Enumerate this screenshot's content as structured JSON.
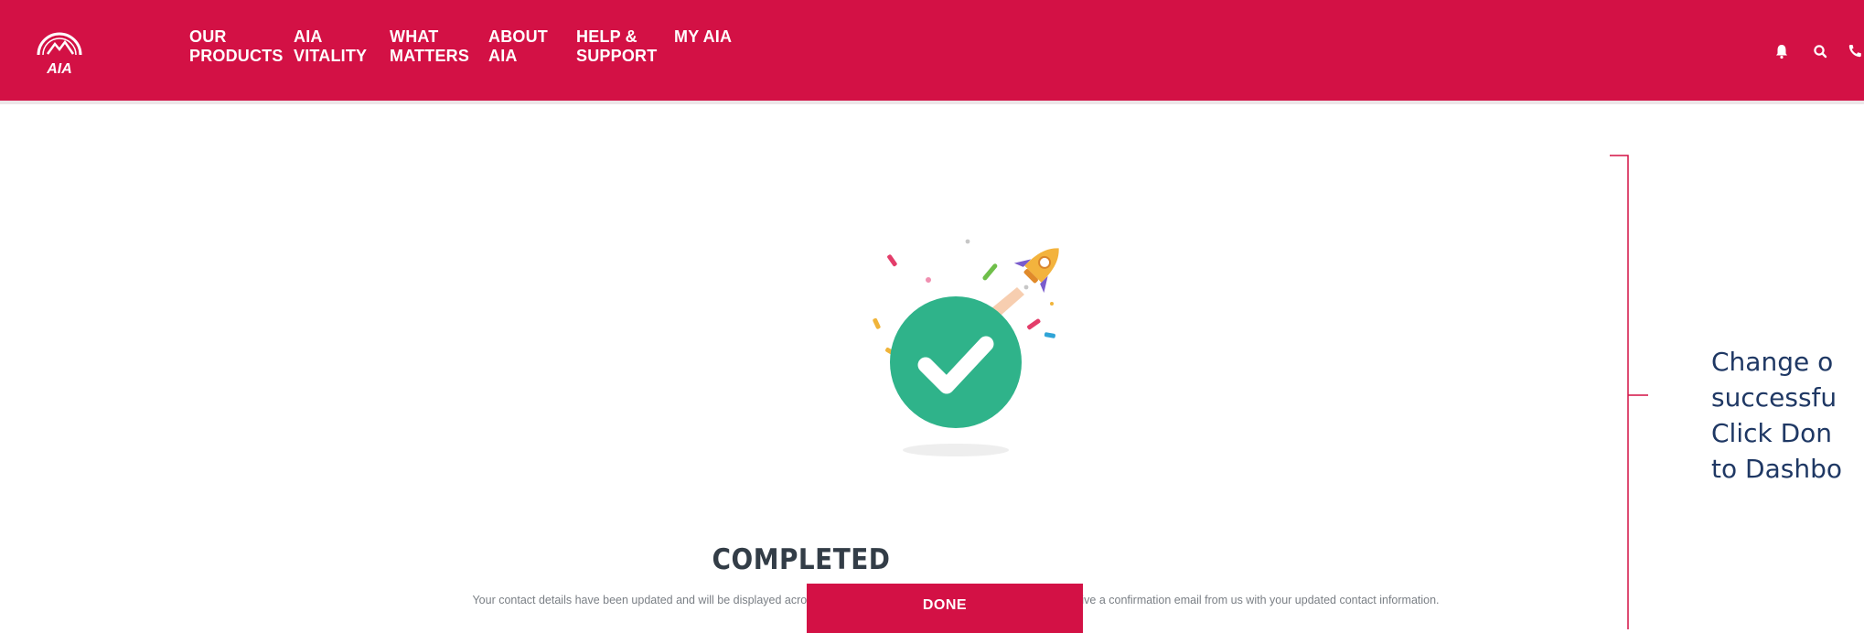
{
  "header": {
    "brand_color": "#d31145",
    "logo_text": "AIA",
    "nav": [
      {
        "line1": "OUR",
        "line2": "PRODUCTS"
      },
      {
        "line1": "AIA",
        "line2": "VITALITY"
      },
      {
        "line1": "WHAT",
        "line2": "MATTERS"
      },
      {
        "line1": "ABOUT",
        "line2": "AIA"
      },
      {
        "line1": "HELP &",
        "line2": "SUPPORT"
      },
      {
        "line1": "",
        "line2": "MY AIA"
      }
    ],
    "icons": [
      "bell-icon",
      "search-icon",
      "phone-icon"
    ]
  },
  "confirmation": {
    "title": "COMPLETED",
    "message": "Your contact details have been updated and will be displayed across all your policies within 3 working days. You will receive a confirmation email from us with your updated contact information.",
    "done_label": "DONE",
    "check_color": "#2fb38a"
  },
  "annotation": {
    "lines": [
      "Change o",
      "successfu",
      "Click Don",
      "to Dashbo"
    ],
    "line_color": "#d31145",
    "text_color": "#1f3864"
  }
}
